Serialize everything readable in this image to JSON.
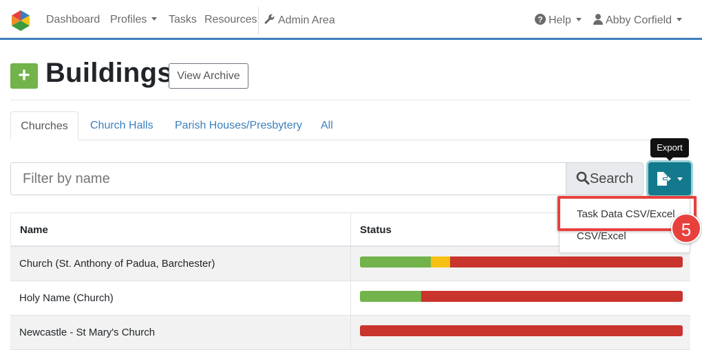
{
  "nav": {
    "dashboard": "Dashboard",
    "profiles": "Profiles",
    "tasks": "Tasks",
    "resources": "Resources",
    "admin_area": "Admin Area",
    "help": "Help",
    "user": "Abby Corfield"
  },
  "page": {
    "add_label": "+",
    "title": "Buildings",
    "view_archive": "View Archive"
  },
  "tabs": [
    {
      "label": "Churches",
      "active": true
    },
    {
      "label": "Church Halls"
    },
    {
      "label": "Parish Houses/Presbytery"
    },
    {
      "label": "All"
    }
  ],
  "search": {
    "placeholder": "Filter by name",
    "button_label": "Search"
  },
  "export": {
    "tooltip": "Export",
    "menu_items": [
      "Task Data CSV/Excel",
      "CSV/Excel"
    ],
    "step_number": "5"
  },
  "table": {
    "headers": {
      "name": "Name",
      "status": "Status"
    },
    "rows": [
      {
        "name": "Church (St. Anthony of Padua, Barchester)",
        "status": {
          "green": 0.22,
          "yellow": 0.06,
          "red": 0.72
        }
      },
      {
        "name": "Holy Name (Church)",
        "status": {
          "green": 0.19,
          "yellow": 0.0,
          "red": 0.81
        }
      },
      {
        "name": "Newcastle - St Mary's Church",
        "status": {
          "green": 0.0,
          "yellow": 0.0,
          "red": 1.0
        }
      }
    ]
  },
  "colors": {
    "brand_blue": "#3a7fbd",
    "add_green": "#72b34b",
    "export_teal": "#127a8c",
    "status_green": "#72b34b",
    "status_yellow": "#f6c114",
    "status_red": "#c9342d",
    "highlight_red": "#e8403d"
  }
}
